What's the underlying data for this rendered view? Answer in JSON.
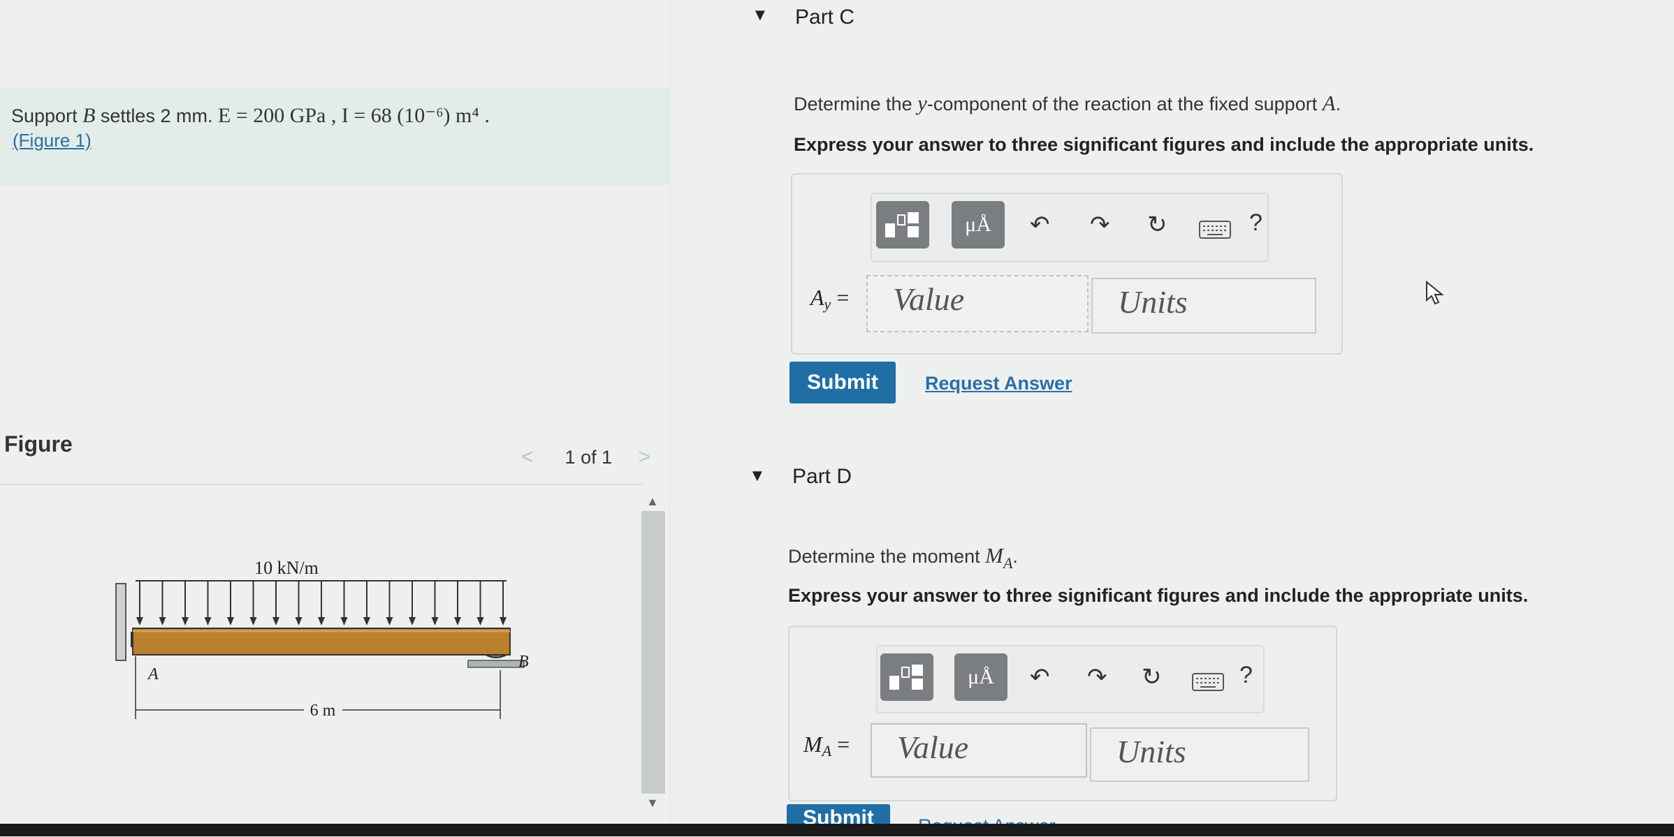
{
  "problem": {
    "prefix": "Support ",
    "support": "B",
    "settle_text": " settles 2 mm. ",
    "params": "E = 200  GPa , I = 68 (10⁻⁶) m⁴ .",
    "figure_link": "(Figure 1)"
  },
  "figure": {
    "title": "Figure",
    "pager_prev": "<",
    "pager_text": "1 of 1",
    "pager_next": ">",
    "load_label": "10 kN/m",
    "label_a": "A",
    "label_b": "B",
    "span_label": "6 m"
  },
  "part_c": {
    "caret": "▼",
    "title": "Part C",
    "question_prefix": "Determine the ",
    "question_var": "y",
    "question_mid": "-component of the reaction at the fixed support ",
    "question_point": "A",
    "question_end": ".",
    "instruction": "Express your answer to three significant figures and include the appropriate units.",
    "var_main": "A",
    "var_sub": "y",
    "var_eq": " =",
    "value_placeholder": "Value",
    "units_placeholder": "Units",
    "submit": "Submit",
    "request": "Request Answer"
  },
  "part_d": {
    "caret": "▼",
    "title": "Part D",
    "question_prefix": "Determine the moment ",
    "question_var": "M",
    "question_sub": "A",
    "question_end": ".",
    "instruction": "Express your answer to three significant figures and include the appropriate units.",
    "var_main": "M",
    "var_sub": "A",
    "var_eq": " =",
    "value_placeholder": "Value",
    "units_placeholder": "Units",
    "submit": "Submit",
    "request": "Request Answer"
  },
  "toolbar": {
    "units_symbol": "μÅ",
    "help": "?",
    "icons": [
      "templates-icon",
      "units-icon",
      "undo-icon",
      "redo-icon",
      "reset-icon",
      "keyboard-icon",
      "help-icon"
    ]
  }
}
